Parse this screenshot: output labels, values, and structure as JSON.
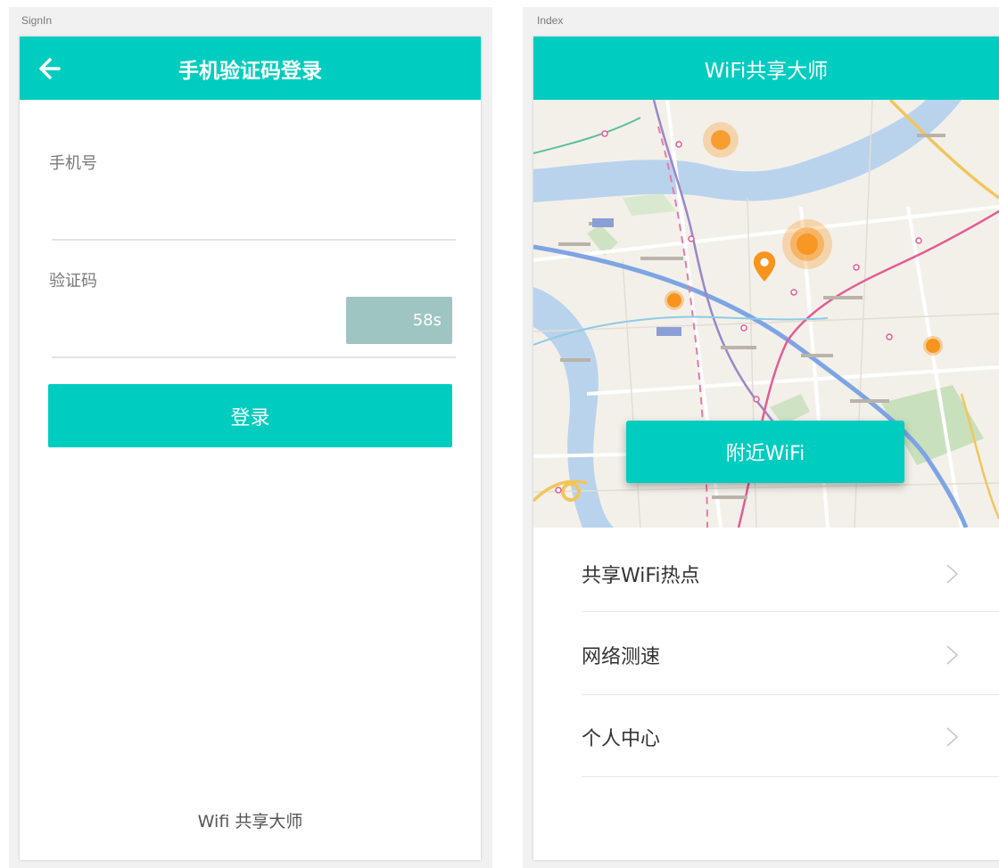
{
  "signin": {
    "artboard_label": "SignIn",
    "title": "手机验证码登录",
    "phone_label": "手机号",
    "code_label": "验证码",
    "countdown": "58s",
    "login_label": "登录",
    "footer": "Wifi 共享大师"
  },
  "index": {
    "artboard_label": "Index",
    "title": "WiFi共享大师",
    "nearby_button": "附近WiFi",
    "menu": [
      {
        "label": "共享WiFi热点"
      },
      {
        "label": "网络测速"
      },
      {
        "label": "个人中心"
      }
    ]
  },
  "colors": {
    "accent": "#00cdbf",
    "countdown_button": "#9ec5c1",
    "marker": "#f7941d"
  },
  "icons": {
    "back": "arrow-left-icon",
    "chevron": "chevron-right-icon",
    "pin": "map-pin-icon"
  }
}
